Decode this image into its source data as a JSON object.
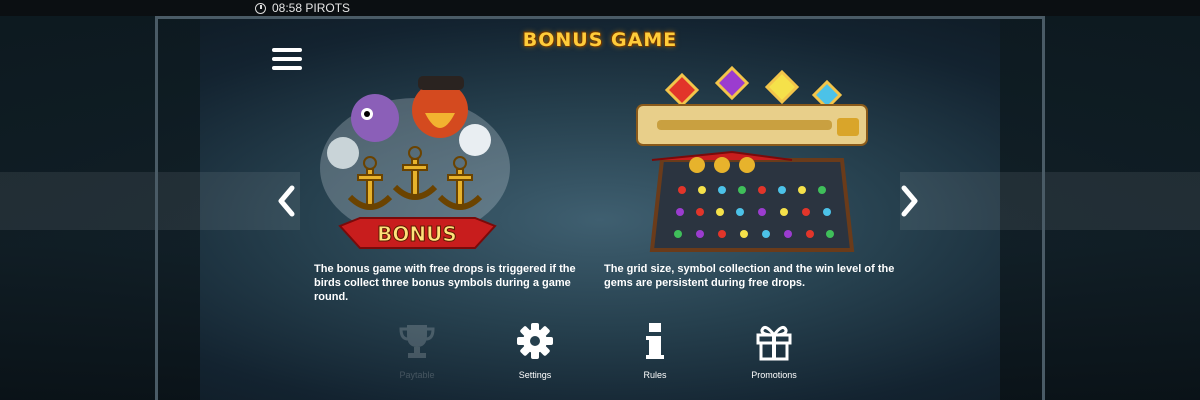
{
  "status_bar": {
    "time_game": "08:58 PIROTS"
  },
  "title": "BONUS GAME",
  "art": {
    "bonus_banner": "BONUS"
  },
  "descriptions": {
    "left": "The bonus game with free drops is triggered if the birds collect three bonus symbols during a game round.",
    "right": "The grid size, symbol collection and the win level of the gems are persistent during free drops."
  },
  "nav": [
    {
      "label": "Paytable",
      "icon": "trophy-icon",
      "active": false
    },
    {
      "label": "Settings",
      "icon": "gear-icon",
      "active": true
    },
    {
      "label": "Rules",
      "icon": "info-icon",
      "active": true
    },
    {
      "label": "Promotions",
      "icon": "gift-icon",
      "active": true
    }
  ],
  "colors": {
    "title": "#ffcc3a",
    "banner_red": "#c81d1d",
    "gold": "#e0a62a",
    "background": "#26404e"
  }
}
